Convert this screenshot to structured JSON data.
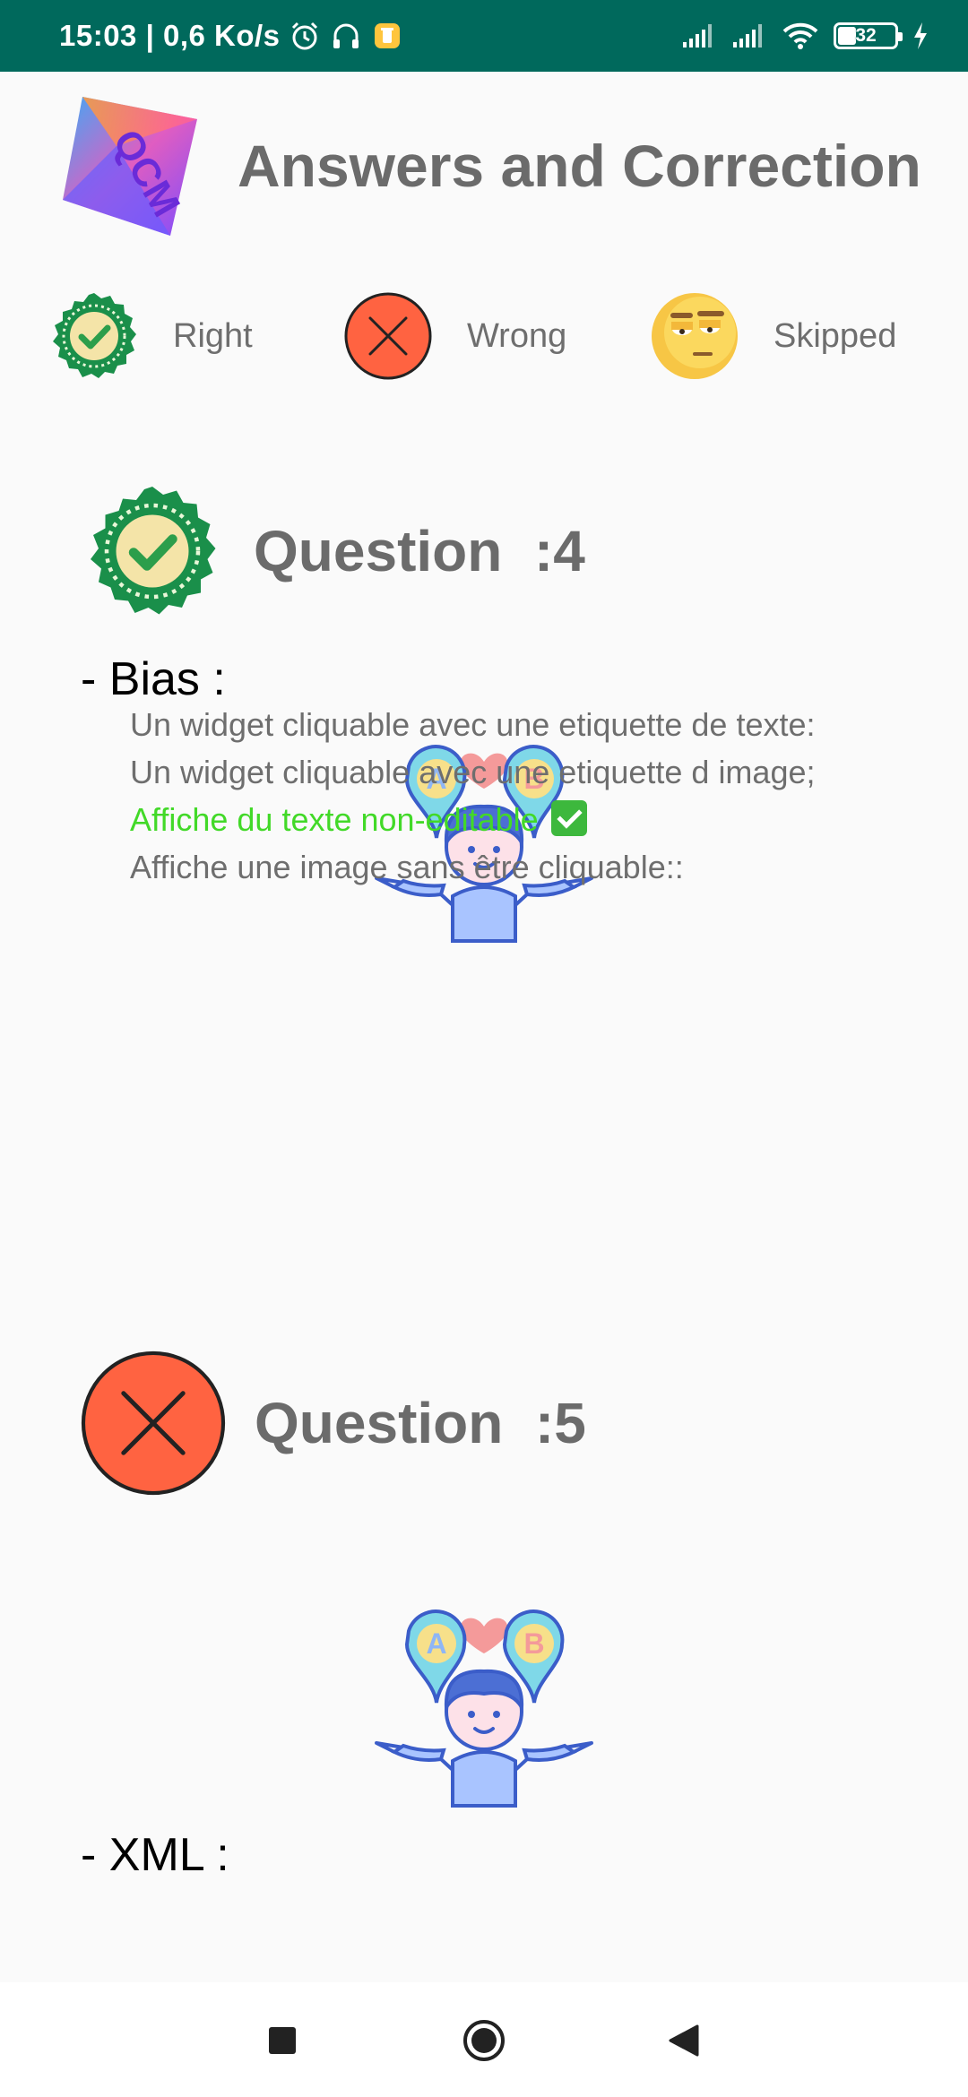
{
  "status_bar": {
    "time_speed": "15:03 | 0,6 Ko/s",
    "battery": "32"
  },
  "header": {
    "logo_text": "QCM",
    "title": "Answers and Correction"
  },
  "legend": {
    "right": "Right",
    "wrong": "Wrong",
    "skipped": "Skipped"
  },
  "questions": [
    {
      "status": "right",
      "title": "Question  :4",
      "illustration_labels": [
        "A",
        "B"
      ],
      "topic": "- Bias :",
      "answers": [
        "Un widget cliquable avec une etiquette de texte:",
        "Un widget cliquable avec une etiquette d image;",
        "Affiche du texte non-editable",
        "Affiche une image sans être cliquable::"
      ],
      "correct_index": 2
    },
    {
      "status": "wrong",
      "title": "Question  :5",
      "illustration_labels": [
        "A",
        "B"
      ],
      "topic": "- XML :"
    }
  ],
  "colors": {
    "status_bar": "#00695c",
    "right": "#1a8f4a",
    "wrong": "#ff6341",
    "skipped": "#f5c03b",
    "correct_text": "#42d928",
    "title_gray": "#6b6b6b"
  },
  "icons": {
    "status": [
      "alarm-icon",
      "headset-icon",
      "notification-icon",
      "signal-icon",
      "wifi-icon",
      "battery-icon",
      "charging-icon"
    ],
    "nav": [
      "recents-square-icon",
      "home-circle-icon",
      "back-triangle-icon"
    ]
  }
}
